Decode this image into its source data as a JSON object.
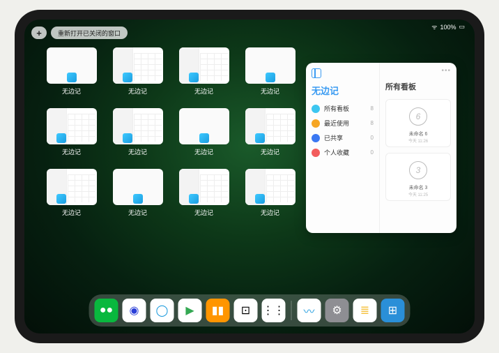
{
  "status": {
    "signal": "􀙇",
    "battery": "100%"
  },
  "topbar": {
    "plus": "+",
    "reopen": "重新打开已关闭的窗口"
  },
  "expose": {
    "app_label": "无边记",
    "items": [
      {
        "variant": "simple"
      },
      {
        "variant": "split"
      },
      {
        "variant": "split"
      },
      {
        "variant": "simple"
      },
      {
        "variant": "split"
      },
      {
        "variant": "split"
      },
      {
        "variant": "simple"
      },
      {
        "variant": "split"
      },
      {
        "variant": "split"
      },
      {
        "variant": "simple"
      },
      {
        "variant": "split"
      },
      {
        "variant": "split"
      }
    ]
  },
  "panel": {
    "title": "无边记",
    "categories": [
      {
        "label": "所有看板",
        "count": "8",
        "color": "#3cc6f0"
      },
      {
        "label": "最近使用",
        "count": "8",
        "color": "#f6a623"
      },
      {
        "label": "已共享",
        "count": "0",
        "color": "#3a78f2"
      },
      {
        "label": "个人收藏",
        "count": "0",
        "color": "#f25c5c"
      }
    ],
    "right_title": "所有看板",
    "boards": [
      {
        "sketch": "6",
        "label": "未命名 6",
        "sub": "今天 11:26"
      },
      {
        "sketch": "3",
        "label": "未命名 3",
        "sub": "今天 11:25"
      }
    ]
  },
  "dock": {
    "items": [
      {
        "name": "wechat",
        "bg": "#09b83e",
        "glyph": "●●"
      },
      {
        "name": "ucbrowser",
        "bg": "#ffffff",
        "glyph": "◉",
        "fg": "#2a3fd8"
      },
      {
        "name": "qqbrowser",
        "bg": "#ffffff",
        "glyph": "◯",
        "fg": "#1296db"
      },
      {
        "name": "play",
        "bg": "#ffffff",
        "glyph": "▶",
        "fg": "#34a853"
      },
      {
        "name": "books",
        "bg": "#ff9500",
        "glyph": "▮▮"
      },
      {
        "name": "dice",
        "bg": "#ffffff",
        "glyph": "⊡",
        "fg": "#000"
      },
      {
        "name": "pods",
        "bg": "#ffffff",
        "glyph": "⋮⋮",
        "fg": "#000"
      }
    ],
    "recent": [
      {
        "name": "freeform",
        "bg": "#ffffff",
        "glyph": "〰",
        "fg": "#2aa0e0"
      },
      {
        "name": "settings",
        "bg": "#8e8e93",
        "glyph": "⚙"
      },
      {
        "name": "notes",
        "bg": "#fff",
        "glyph": "≣",
        "fg": "#f6c344"
      },
      {
        "name": "apps",
        "bg": "#2a8fd8",
        "glyph": "⊞"
      }
    ]
  }
}
